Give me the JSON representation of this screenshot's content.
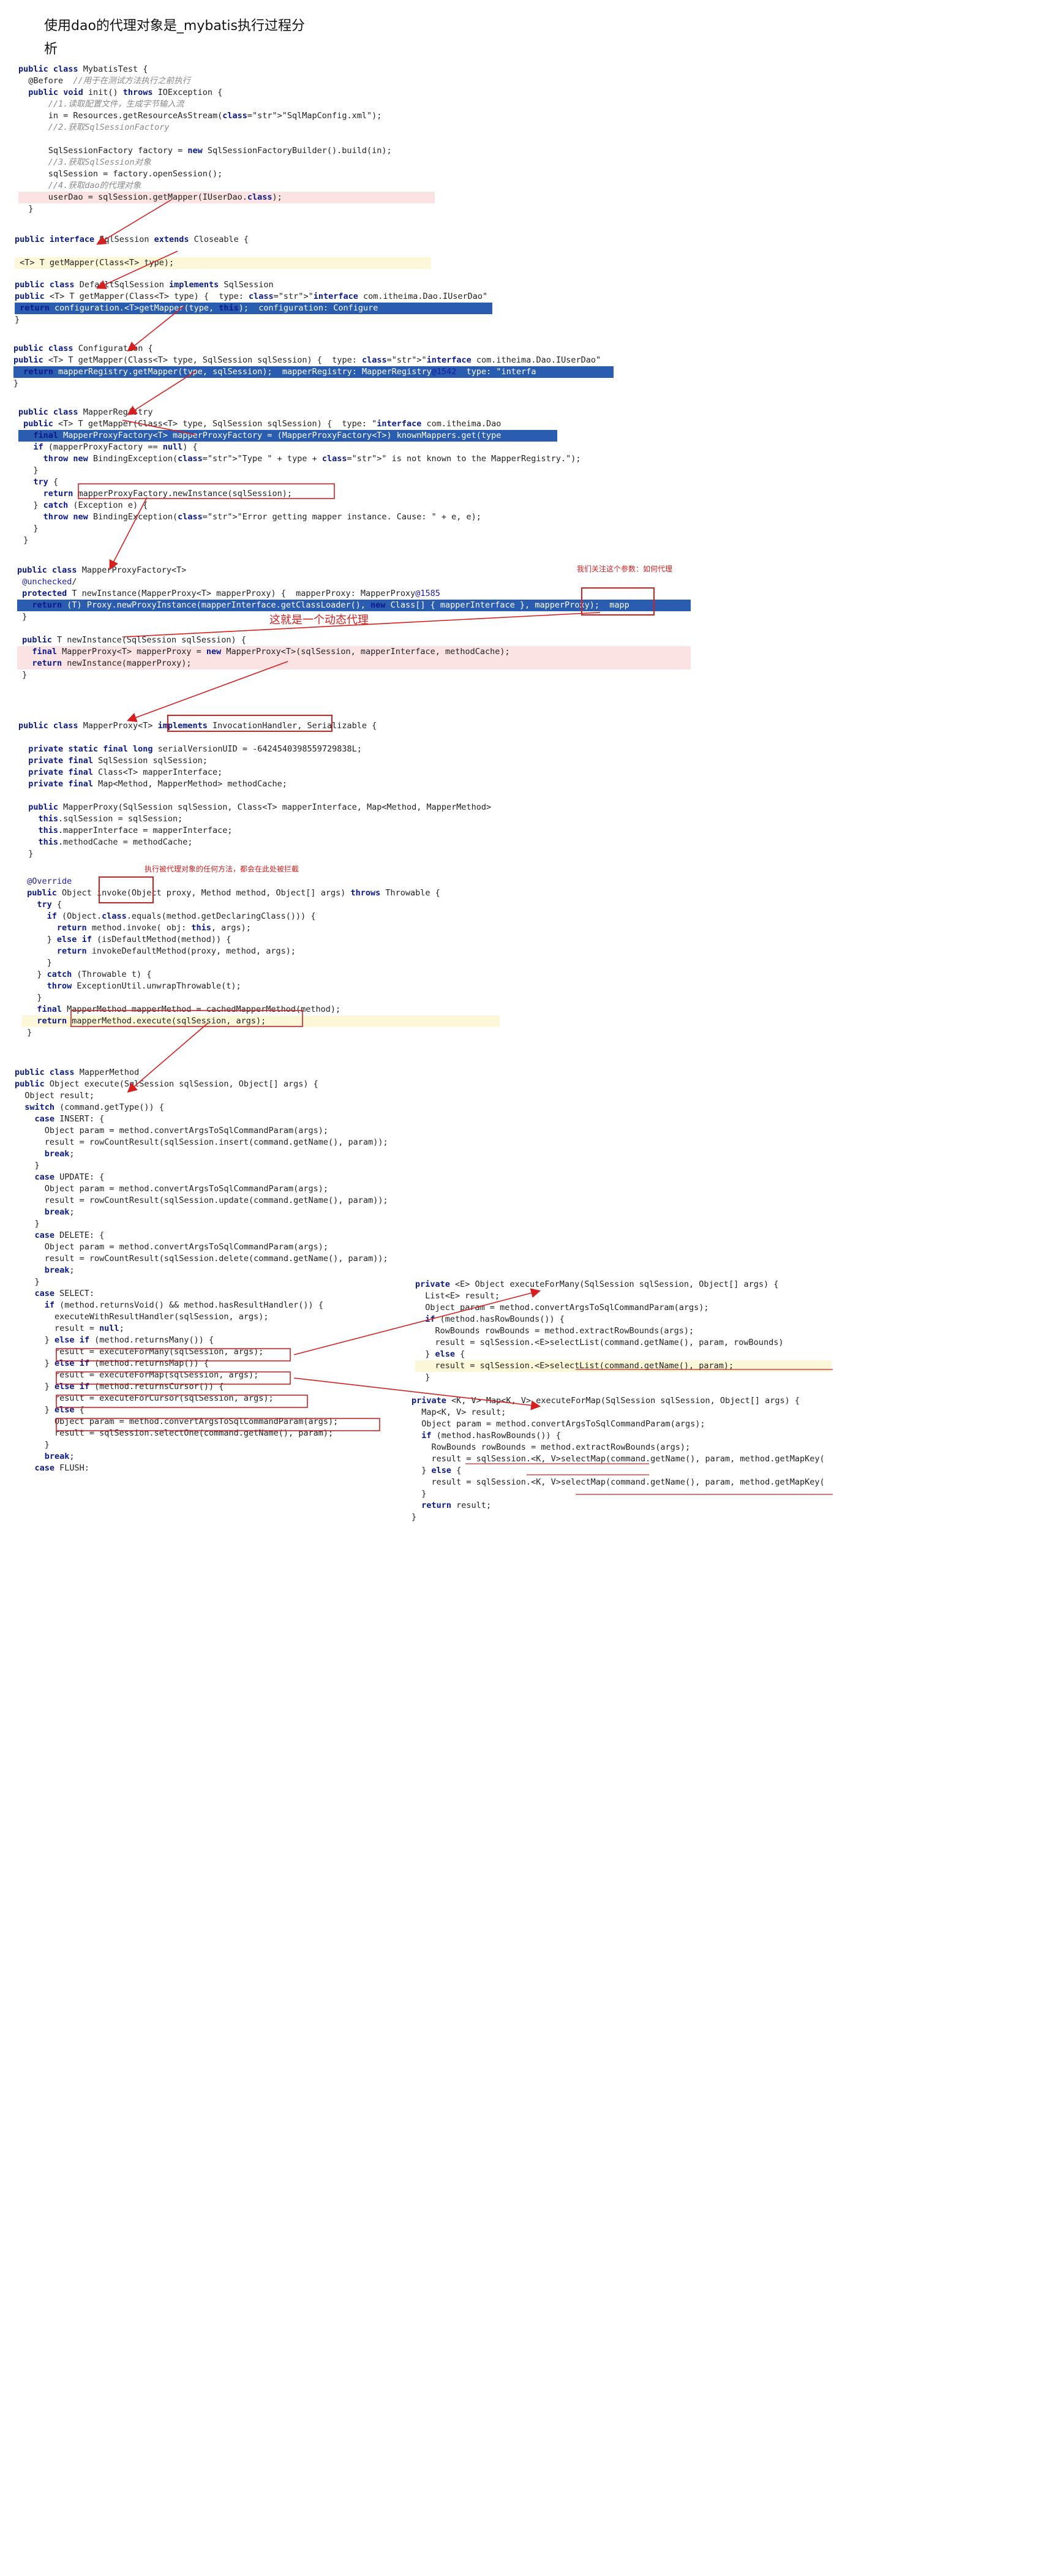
{
  "title": "使用dao的代理对象是_mybatis执行过程分析",
  "notes": {
    "proxy_param": "我们关注这个参数：如何代理",
    "dynamic_proxy": "这就是一个动态代理",
    "invoke_note": "执行被代理对象的任何方法，都会在此处被拦截"
  },
  "blocks": [
    {
      "name": "mybatis-test-block",
      "lines": [
        "public class MybatisTest {",
        "  @Before  //用于在测试方法执行之前执行",
        "  public void init() throws IOException {",
        "      //1.读取配置文件，生成字节输入流",
        "      in = Resources.getResourceAsStream(\"SqlMapConfig.xml\");",
        "      //2.获取SqlSessionFactory",
        "",
        "      SqlSessionFactory factory = new SqlSessionFactoryBuilder().build(in);",
        "      //3.获取SqlSession对象",
        "      sqlSession = factory.openSession();",
        "      //4.获取dao的代理对象",
        "      userDao = sqlSession.getMapper(IUserDao.class);",
        "  }"
      ]
    },
    {
      "name": "sqlsession-interface-block",
      "lines": [
        "public interface SqlSession extends Closeable {",
        "",
        " <T> T getMapper(Class<T> type);"
      ]
    },
    {
      "name": "default-sqlsession-block",
      "lines": [
        "public class DefaultSqlSession implements SqlSession",
        "public <T> T getMapper(Class<T> type) {  type: \"interface com.itheima.Dao.IUserDao\"",
        " return configuration.<T>getMapper(type, this);  configuration: Configure",
        "}"
      ]
    },
    {
      "name": "configuration-block",
      "lines": [
        "public class Configuration {",
        "public <T> T getMapper(Class<T> type, SqlSession sqlSession) {  type: \"interface com.itheima.Dao.IUserDao\"",
        "  return mapperRegistry.getMapper(type, sqlSession);  mapperRegistry: MapperRegistry@1542  type: \"interfa",
        "}"
      ]
    },
    {
      "name": "mapper-registry-block",
      "lines": [
        "public class MapperRegistry",
        " public <T> T getMapper(Class<T> type, SqlSession sqlSession) {  type: \"interface com.itheima.Dao",
        "   final MapperProxyFactory<T> mapperProxyFactory = (MapperProxyFactory<T>) knownMappers.get(type",
        "   if (mapperProxyFactory == null) {",
        "     throw new BindingException(\"Type \" + type + \" is not known to the MapperRegistry.\");",
        "   }",
        "   try {",
        "     return mapperProxyFactory.newInstance(sqlSession);",
        "   } catch (Exception e) {",
        "     throw new BindingException(\"Error getting mapper instance. Cause: \" + e, e);",
        "   }",
        " }"
      ]
    },
    {
      "name": "mapper-proxy-factory-block",
      "lines": [
        "public class MapperProxyFactory<T>",
        " @unchecked/",
        " protected T newInstance(MapperProxy<T> mapperProxy) {  mapperProxy: MapperProxy@1585",
        "   return (T) Proxy.newProxyInstance(mapperInterface.getClassLoader(), new Class[] { mapperInterface }, mapperProxy);  mapp",
        " }",
        "",
        " public T newInstance(SqlSession sqlSession) {",
        "   final MapperProxy<T> mapperProxy = new MapperProxy<T>(sqlSession, mapperInterface, methodCache);",
        "   return newInstance(mapperProxy);",
        " }"
      ]
    },
    {
      "name": "mapper-proxy-block",
      "lines": [
        "public class MapperProxy<T> implements InvocationHandler, Serializable {",
        "",
        "  private static final long serialVersionUID = -6424540398559729838L;",
        "  private final SqlSession sqlSession;",
        "  private final Class<T> mapperInterface;",
        "  private final Map<Method, MapperMethod> methodCache;",
        "",
        "  public MapperProxy(SqlSession sqlSession, Class<T> mapperInterface, Map<Method, MapperMethod>",
        "    this.sqlSession = sqlSession;",
        "    this.mapperInterface = mapperInterface;",
        "    this.methodCache = methodCache;",
        "  }"
      ]
    },
    {
      "name": "invoke-block",
      "lines": [
        " @Override",
        " public Object invoke(Object proxy, Method method, Object[] args) throws Throwable {",
        "   try {",
        "     if (Object.class.equals(method.getDeclaringClass())) {",
        "       return method.invoke( obj: this, args);",
        "     } else if (isDefaultMethod(method)) {",
        "       return invokeDefaultMethod(proxy, method, args);",
        "     }",
        "   } catch (Throwable t) {",
        "     throw ExceptionUtil.unwrapThrowable(t);",
        "   }",
        "   final MapperMethod mapperMethod = cachedMapperMethod(method);",
        "   return mapperMethod.execute(sqlSession, args);",
        " }"
      ]
    },
    {
      "name": "mapper-method-block",
      "lines": [
        "public class MapperMethod",
        "public Object execute(SqlSession sqlSession, Object[] args) {",
        "  Object result;",
        "  switch (command.getType()) {",
        "    case INSERT: {",
        "      Object param = method.convertArgsToSqlCommandParam(args);",
        "      result = rowCountResult(sqlSession.insert(command.getName(), param));",
        "      break;",
        "    }",
        "    case UPDATE: {",
        "      Object param = method.convertArgsToSqlCommandParam(args);",
        "      result = rowCountResult(sqlSession.update(command.getName(), param));",
        "      break;",
        "    }",
        "    case DELETE: {",
        "      Object param = method.convertArgsToSqlCommandParam(args);",
        "      result = rowCountResult(sqlSession.delete(command.getName(), param));",
        "      break;",
        "    }",
        "    case SELECT:",
        "      if (method.returnsVoid() && method.hasResultHandler()) {",
        "        executeWithResultHandler(sqlSession, args);",
        "        result = null;",
        "      } else if (method.returnsMany()) {",
        "        result = executeForMany(sqlSession, args);",
        "      } else if (method.returnsMap()) {",
        "        result = executeForMap(sqlSession, args);",
        "      } else if (method.returnsCursor()) {",
        "        result = executeForCursor(sqlSession, args);",
        "      } else {",
        "        Object param = method.convertArgsToSqlCommandParam(args);",
        "        result = sqlSession.selectOne(command.getName(), param);",
        "      }",
        "      break;",
        "    case FLUSH:"
      ]
    },
    {
      "name": "execute-for-many-block",
      "lines": [
        "private <E> Object executeForMany(SqlSession sqlSession, Object[] args) {",
        "  List<E> result;",
        "  Object param = method.convertArgsToSqlCommandParam(args);",
        "  if (method.hasRowBounds()) {",
        "    RowBounds rowBounds = method.extractRowBounds(args);",
        "    result = sqlSession.<E>selectList(command.getName(), param, rowBounds)",
        "  } else {",
        "    result = sqlSession.<E>selectList(command.getName(), param);",
        "  }"
      ]
    },
    {
      "name": "execute-for-map-block",
      "lines": [
        "private <K, V> Map<K, V> executeForMap(SqlSession sqlSession, Object[] args) {",
        "  Map<K, V> result;",
        "  Object param = method.convertArgsToSqlCommandParam(args);",
        "  if (method.hasRowBounds()) {",
        "    RowBounds rowBounds = method.extractRowBounds(args);",
        "    result = sqlSession.<K, V>selectMap(command.getName(), param, method.getMapKey(",
        "  } else {",
        "    result = sqlSession.<K, V>selectMap(command.getName(), param, method.getMapKey(",
        "  }",
        "  return result;",
        "}"
      ]
    }
  ]
}
